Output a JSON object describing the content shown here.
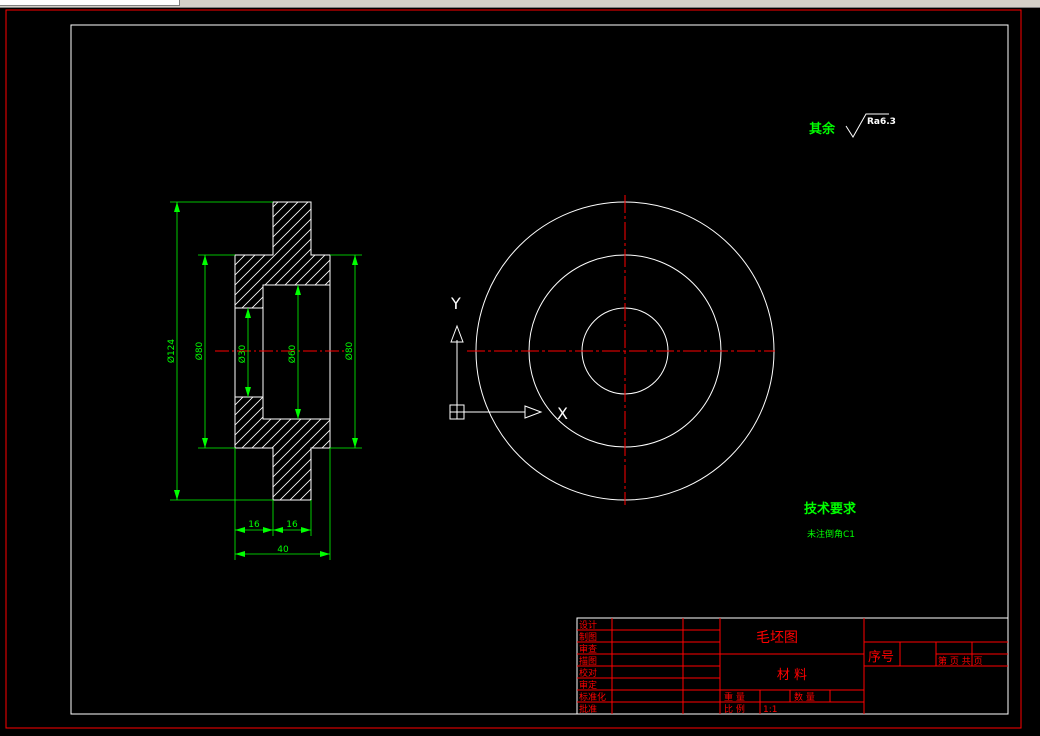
{
  "colors": {
    "background": "#000000",
    "frame": "#ff0000",
    "white_line": "#ffffff",
    "green_text": "#00ff00",
    "center_line": "#ff0000",
    "title_text": "#ff0000"
  },
  "annotations": {
    "roughness_prefix": "其余",
    "roughness_value": "Ra6.3",
    "tech_title": "技术要求",
    "tech_note": "未注倒角C1"
  },
  "dimensions": {
    "dia_outer": "Ø124",
    "dia_hub_left": "Ø80",
    "dia_bore_small": "Ø30",
    "dia_bore_big": "Ø60",
    "dia_hub_right": "Ø80",
    "len_16_a": "16",
    "len_16_b": "16",
    "len_total": "40"
  },
  "ucs": {
    "x_label": "X",
    "y_label": "Y"
  },
  "title_block": {
    "left_labels": [
      "设计",
      "制图",
      "审查",
      "描图",
      "校对",
      "审定",
      "标准化",
      "批准"
    ],
    "drawing_name": "毛坯图",
    "material": "材 料",
    "weight_label": "重 量",
    "quantity_label": "数 量",
    "scale_label": "比 例",
    "scale_value": "1:1",
    "seq_label": "序号",
    "sheet_label": "第 页 共 页"
  }
}
